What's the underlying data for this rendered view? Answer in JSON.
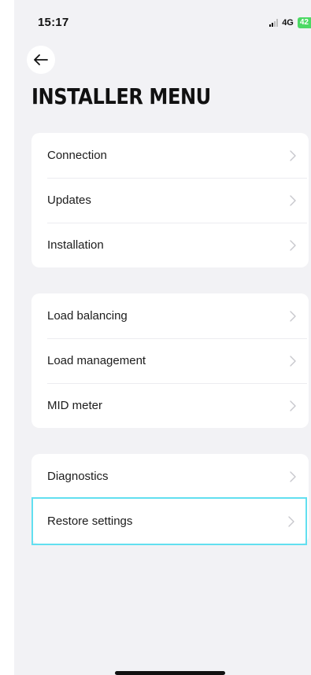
{
  "status_bar": {
    "time": "15:17",
    "network": "4G",
    "battery": "42"
  },
  "header": {
    "back_icon": "arrow-left-icon",
    "title": "INSTALLER MENU"
  },
  "menu_groups": [
    {
      "items": [
        {
          "label": "Connection"
        },
        {
          "label": "Updates"
        },
        {
          "label": "Installation"
        }
      ]
    },
    {
      "items": [
        {
          "label": "Load balancing"
        },
        {
          "label": "Load management"
        },
        {
          "label": "MID meter"
        }
      ]
    },
    {
      "items": [
        {
          "label": "Diagnostics"
        },
        {
          "label": "Restore settings",
          "highlighted": true
        }
      ]
    }
  ],
  "colors": {
    "background": "#f2f2f5",
    "card": "#ffffff",
    "highlight_outline": "#62dff0",
    "battery": "#4cd964"
  }
}
